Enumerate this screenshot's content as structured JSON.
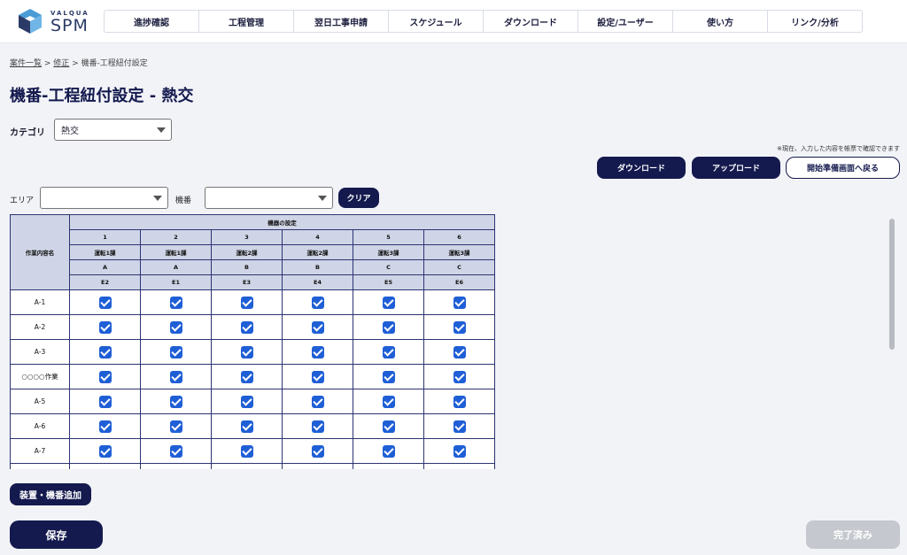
{
  "header": {
    "logo_small": "VALQUA",
    "logo_big": "SPM",
    "nav": [
      "進捗確認",
      "工程管理",
      "翌日工事申請",
      "スケジュール",
      "ダウンロード",
      "設定/ユーザー",
      "使い方",
      "リンク/分析"
    ]
  },
  "breadcrumb": {
    "item1": "案件一覧",
    "sep": " > ",
    "item2": "修正",
    "current": "機番-工程紐付設定"
  },
  "page_title": "機番-工程紐付設定 - 熱交",
  "category": {
    "label": "カテゴリ",
    "value": "熱交"
  },
  "note": "※現在、入力した内容を帳票で確認できます",
  "buttons": {
    "download": "ダウンロード",
    "upload": "アップロード",
    "back": "開始準備画面へ戻る",
    "clear": "クリア",
    "add": "装置・機番追加",
    "save": "保存",
    "done": "完了済み"
  },
  "filters": {
    "area_label": "エリア",
    "area_value": "",
    "machine_label": "機番",
    "machine_value": ""
  },
  "table": {
    "row_header": "作業内容名",
    "group_header": "機器の設定",
    "columns": [
      {
        "no": "1",
        "dept": "運転1課",
        "group": "A",
        "code": "E2"
      },
      {
        "no": "2",
        "dept": "運転1課",
        "group": "A",
        "code": "E1"
      },
      {
        "no": "3",
        "dept": "運転2課",
        "group": "B",
        "code": "E3"
      },
      {
        "no": "4",
        "dept": "運転2課",
        "group": "B",
        "code": "E4"
      },
      {
        "no": "5",
        "dept": "運転3課",
        "group": "C",
        "code": "E5"
      },
      {
        "no": "6",
        "dept": "運転3課",
        "group": "C",
        "code": "E6"
      }
    ],
    "rows": [
      {
        "name": "A-1",
        "checked": [
          true,
          true,
          true,
          true,
          true,
          true
        ]
      },
      {
        "name": "A-2",
        "checked": [
          true,
          true,
          true,
          true,
          true,
          true
        ]
      },
      {
        "name": "A-3",
        "checked": [
          true,
          true,
          true,
          true,
          true,
          true
        ]
      },
      {
        "name": "○○○○作業",
        "checked": [
          true,
          true,
          true,
          true,
          true,
          true
        ]
      },
      {
        "name": "A-5",
        "checked": [
          true,
          true,
          true,
          true,
          true,
          true
        ]
      },
      {
        "name": "A-6",
        "checked": [
          true,
          true,
          true,
          true,
          true,
          true
        ]
      },
      {
        "name": "A-7",
        "checked": [
          true,
          true,
          true,
          true,
          true,
          true
        ]
      },
      {
        "name": "",
        "checked": [
          false,
          false,
          false,
          false,
          false,
          false
        ]
      }
    ]
  },
  "colors": {
    "primary": "#141a4e",
    "checkbox": "#1f5fd6",
    "header_bg": "#cfd5e6"
  }
}
